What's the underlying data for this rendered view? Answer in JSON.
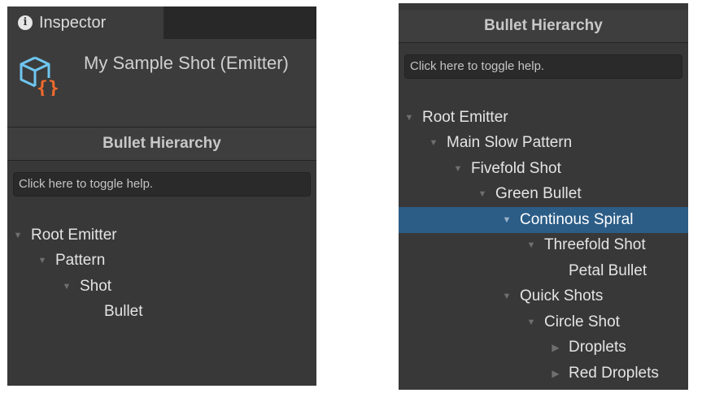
{
  "left_panel": {
    "tab_label": "Inspector",
    "object_title": "My Sample Shot (Emitter)",
    "section_title": "Bullet Hierarchy",
    "help_text": "Click here to toggle help.",
    "tree": [
      {
        "label": "Root Emitter",
        "depth": 0,
        "arrow": "expanded"
      },
      {
        "label": "Pattern",
        "depth": 1,
        "arrow": "expanded"
      },
      {
        "label": "Shot",
        "depth": 2,
        "arrow": "expanded"
      },
      {
        "label": "Bullet",
        "depth": 3,
        "arrow": "none"
      }
    ]
  },
  "right_panel": {
    "section_title": "Bullet Hierarchy",
    "help_text": "Click here to toggle help.",
    "tree": [
      {
        "label": "Root Emitter",
        "depth": 0,
        "arrow": "expanded"
      },
      {
        "label": "Main Slow Pattern",
        "depth": 1,
        "arrow": "expanded"
      },
      {
        "label": "Fivefold Shot",
        "depth": 2,
        "arrow": "expanded"
      },
      {
        "label": "Green Bullet",
        "depth": 3,
        "arrow": "expanded"
      },
      {
        "label": "Continous Spiral",
        "depth": 4,
        "arrow": "expanded",
        "selected": true
      },
      {
        "label": "Threefold Shot",
        "depth": 5,
        "arrow": "expanded"
      },
      {
        "label": "Petal Bullet",
        "depth": 6,
        "arrow": "none"
      },
      {
        "label": "Quick Shots",
        "depth": 4,
        "arrow": "expanded"
      },
      {
        "label": "Circle Shot",
        "depth": 5,
        "arrow": "expanded"
      },
      {
        "label": "Droplets",
        "depth": 6,
        "arrow": "collapsed"
      },
      {
        "label": "Red Droplets",
        "depth": 6,
        "arrow": "collapsed"
      }
    ]
  },
  "colors": {
    "panel_bg": "#383838",
    "selection": "#2c5d87",
    "selection_text": "#ffffff",
    "icon_accent": "#f06a2c",
    "icon_line": "#6ec6f0"
  }
}
